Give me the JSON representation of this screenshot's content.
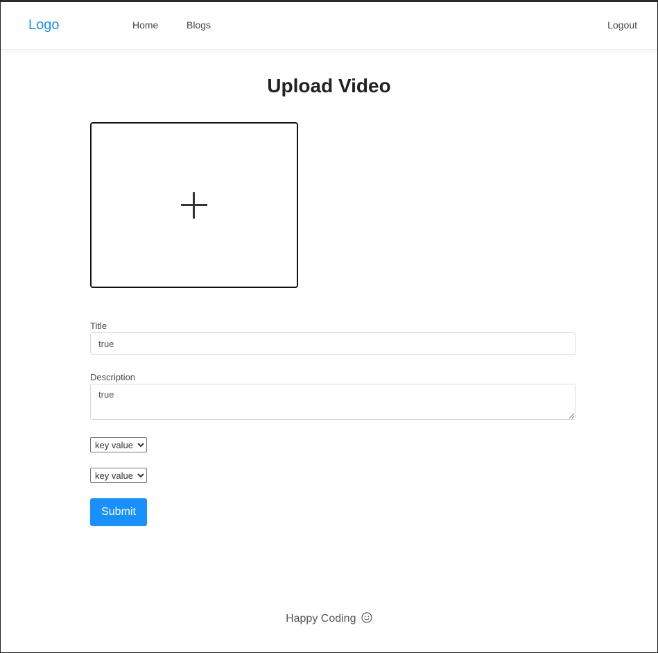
{
  "navbar": {
    "logo": "Logo",
    "home": "Home",
    "blogs": "Blogs",
    "logout": "Logout"
  },
  "page": {
    "title": "Upload Video"
  },
  "upload": {
    "icon": "plus-icon"
  },
  "form": {
    "title_label": "Title",
    "title_value": "true",
    "description_label": "Description",
    "description_value": "true",
    "select_1_value": "key value",
    "select_2_value": "key value",
    "submit_label": "Submit"
  },
  "footer": {
    "text": "Happy Coding",
    "icon": "smile-icon"
  },
  "colors": {
    "accent": "#1890ff"
  }
}
